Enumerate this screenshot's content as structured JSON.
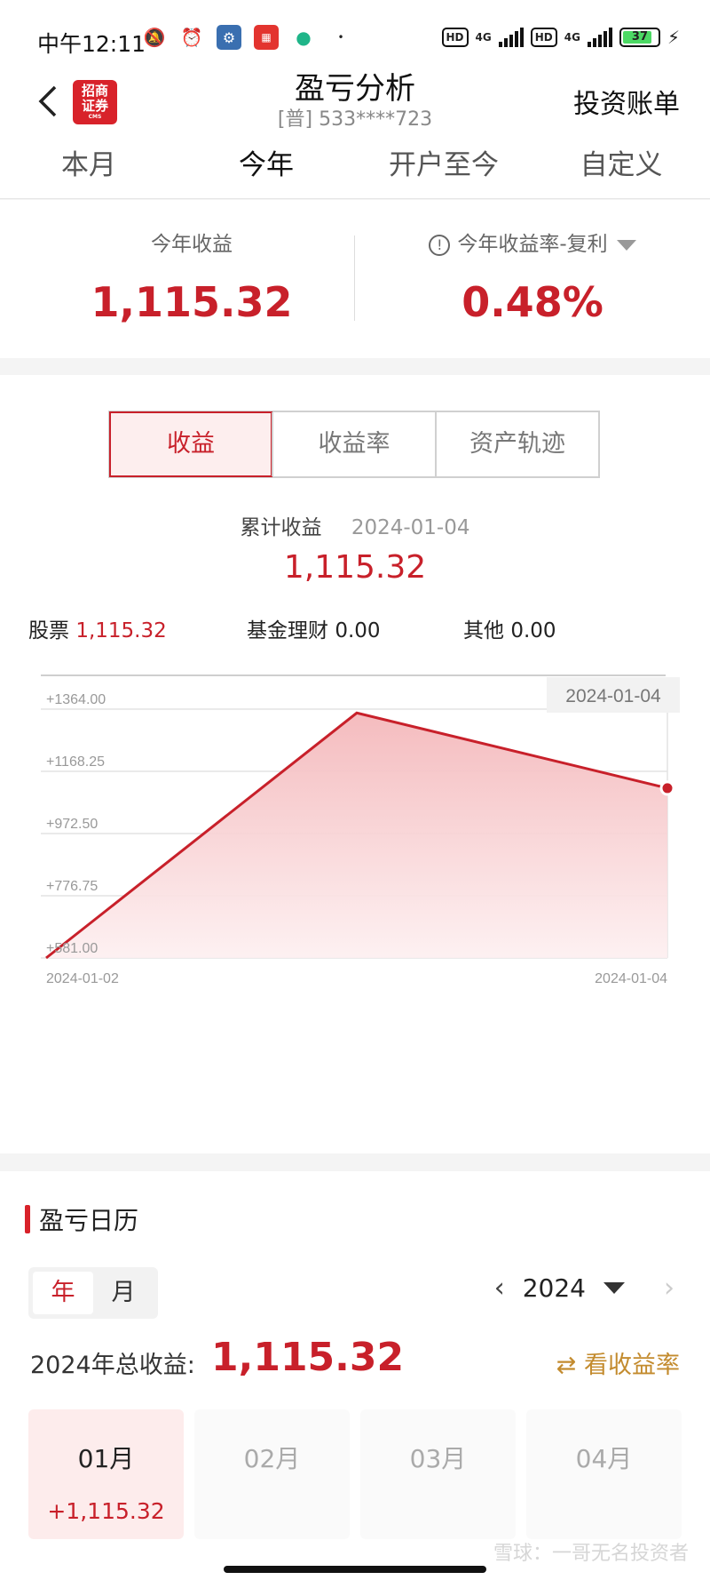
{
  "status_bar": {
    "time": "中午12:11",
    "network_1": "4G",
    "network_2": "4G",
    "hd_label": "HD",
    "battery": "37"
  },
  "header": {
    "title": "盈亏分析",
    "account": "[普] 533****723",
    "logo_text": "招商证券",
    "logo_sub": "CMS",
    "right_link": "投资账单"
  },
  "period_tabs": [
    "本月",
    "今年",
    "开户至今",
    "自定义"
  ],
  "summary": {
    "profit_label": "今年收益",
    "profit_value": "1,115.32",
    "rate_label": "今年收益率-复利",
    "rate_value": "0.48%"
  },
  "chart_tabs": [
    "收益",
    "收益率",
    "资产轨迹"
  ],
  "cumulative": {
    "label": "累计收益",
    "date": "2024-01-04",
    "value": "1,115.32"
  },
  "breakdown": {
    "stock_label": "股票",
    "stock_value": "1,115.32",
    "fund_label": "基金理财",
    "fund_value": "0.00",
    "other_label": "其他",
    "other_value": "0.00"
  },
  "chart_data": {
    "type": "area",
    "x": [
      "2024-01-02",
      "2024-01-03",
      "2024-01-04"
    ],
    "series": [
      {
        "values": [
          581.0,
          1352,
          1115.32
        ]
      }
    ],
    "ylim": [
      581.0,
      1364.0
    ],
    "yticks": [
      "+1364.00",
      "+1168.25",
      "+972.50",
      "+776.75",
      "+581.00"
    ],
    "x_tick_labels": [
      "2024-01-02",
      "2024-01-04"
    ],
    "tooltip_date": "2024-01-04",
    "line_color": "#c8202a",
    "grid": true
  },
  "calendar": {
    "title": "盈亏日历",
    "year_btn": "年",
    "month_btn": "月",
    "year": "2024",
    "total_label": "2024年总收益:",
    "total_value": "1,115.32",
    "rate_link": "看收益率",
    "months": [
      {
        "name": "01月",
        "value": "+1,115.32"
      },
      {
        "name": "02月",
        "value": ""
      },
      {
        "name": "03月",
        "value": ""
      },
      {
        "name": "04月",
        "value": ""
      }
    ],
    "watermark": "雪球：一哥无名投资者"
  },
  "colors": {
    "accent": "#c8202a",
    "gold": "#c38b2e"
  }
}
